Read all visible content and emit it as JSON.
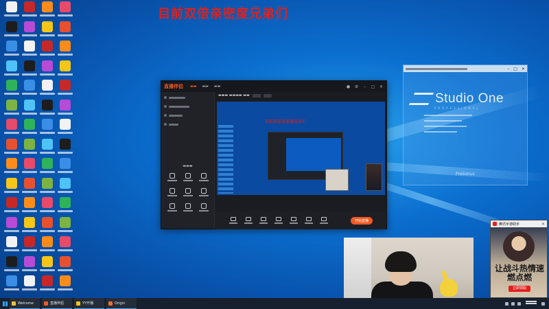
{
  "overlay_text": "目前双倍亲密度兄弟们",
  "stream_app": {
    "name": "直播伴侣",
    "preview_overlay_text": "目前双倍亲密度兄弟们",
    "go_live_label": "开始直播"
  },
  "studio_one": {
    "logo_name": "Studio One",
    "subtitle": "PROFESSIONAL",
    "brand": "PreSonus"
  },
  "ad": {
    "header": "腾讯手游助手",
    "slogan": "让战斗热情速燃点燃",
    "button": "立即领取"
  },
  "taskbar": {
    "items": [
      {
        "label": "Welcome",
        "icon": "folder-icon",
        "color": "#f0c040"
      },
      {
        "label": "直播伴侣",
        "icon": "stream-app-icon",
        "color": "#f15a24"
      },
      {
        "label": "YY开播",
        "icon": "yy-icon",
        "color": "#f5c518"
      },
      {
        "label": "Origin",
        "icon": "origin-icon",
        "color": "#f56c2d"
      }
    ]
  },
  "colors": {
    "overlay_red": "#e0201c",
    "accent_orange": "#f15a24",
    "desktop_blue": "#0b6fd0"
  }
}
